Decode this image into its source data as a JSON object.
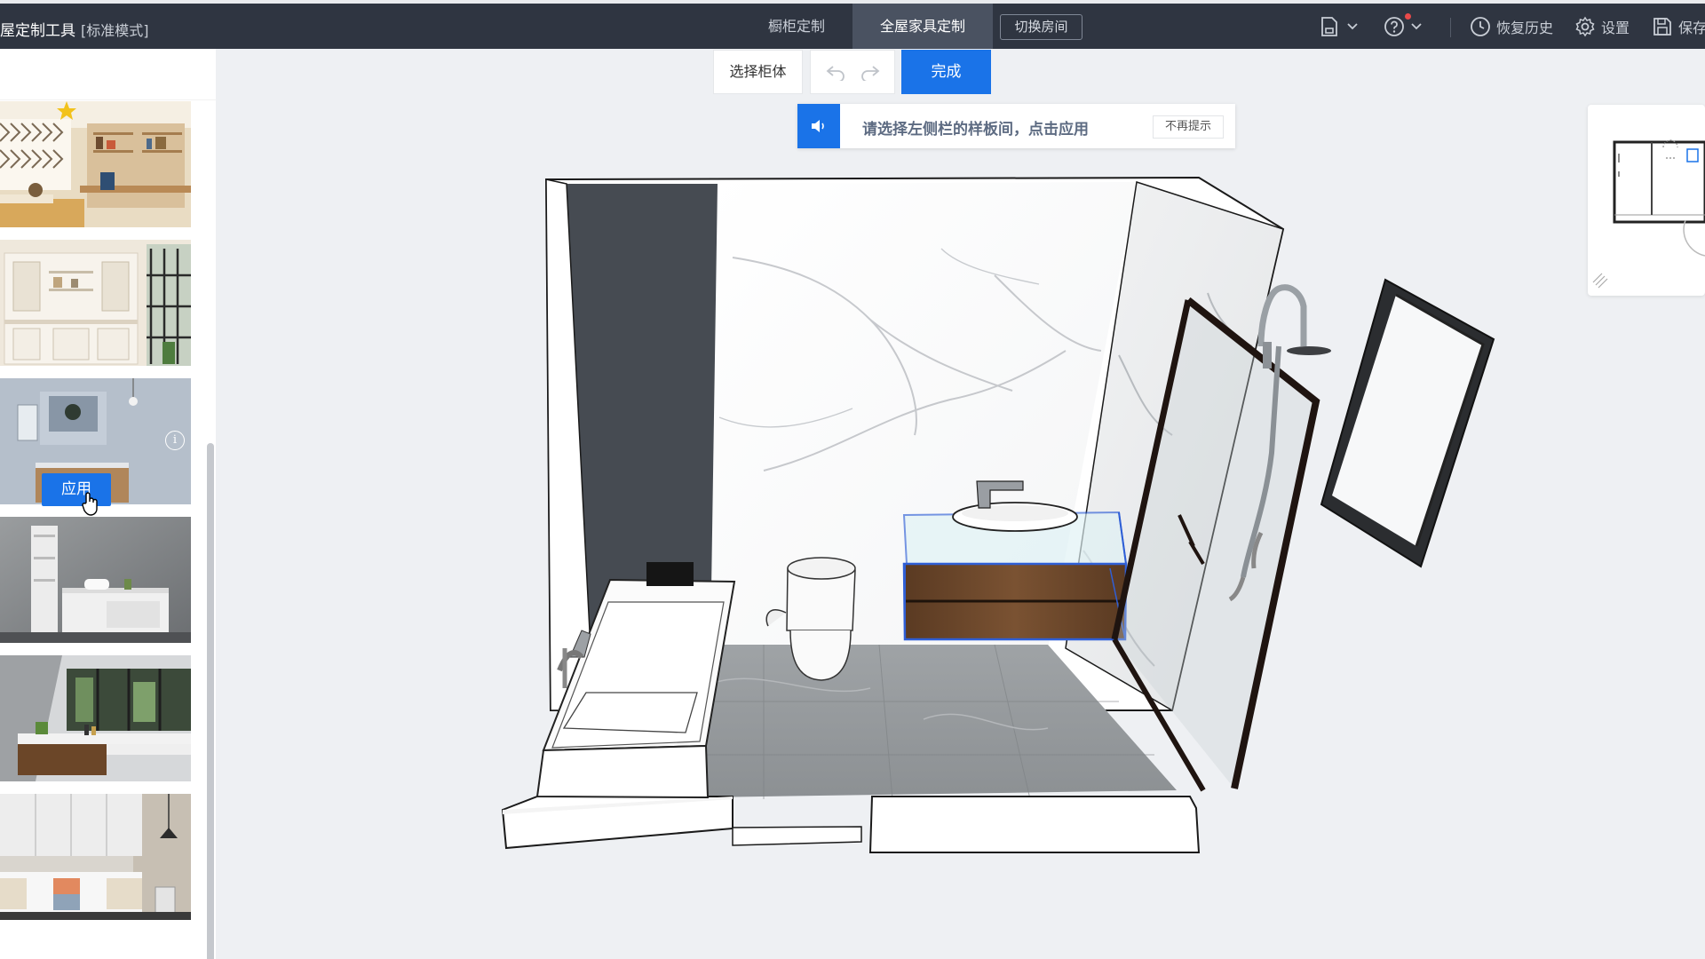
{
  "header": {
    "app_title": "屋定制工具",
    "mode_label": "[标准模式]",
    "tabs": [
      {
        "label": "橱柜定制",
        "active": false
      },
      {
        "label": "全屋家具定制",
        "active": true
      }
    ],
    "switch_room_label": "切换房间",
    "restore_history_label": "恢复历史",
    "settings_label": "设置",
    "save_label": "保存"
  },
  "toolbar": {
    "select_cabinet_label": "选择柜体",
    "done_label": "完成"
  },
  "hint": {
    "text": "请选择左侧栏的样板间，点击应用",
    "dismiss_label": "不再提示"
  },
  "sidebar": {
    "templates": [
      {
        "name": "study-bedroom"
      },
      {
        "name": "white-cabinet-wall"
      },
      {
        "name": "bathroom-blue-grey",
        "hovered": true
      },
      {
        "name": "grey-bathroom-vanity"
      },
      {
        "name": "wood-sink-counter"
      },
      {
        "name": "white-storage-wall"
      }
    ],
    "apply_label": "应用"
  },
  "colors": {
    "topbar_bg": "#2f3541",
    "accent": "#1a73e8",
    "canvas_bg": "#eef0f3"
  }
}
